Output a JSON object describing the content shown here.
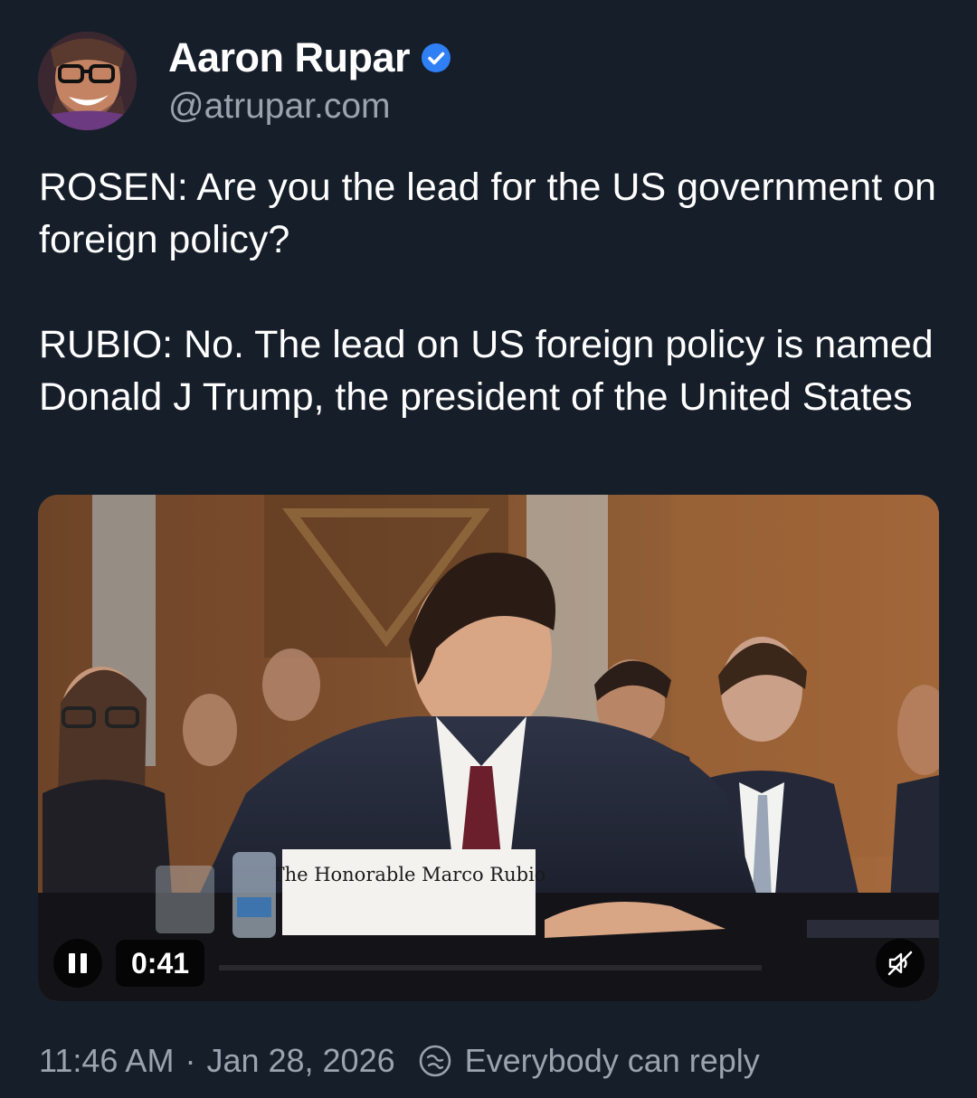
{
  "author": {
    "display_name": "Aaron Rupar",
    "handle": "@atrupar.com",
    "avatar_icon": "avatar",
    "verified_icon": "verified-badge-icon",
    "verified_color": "#2f7ff5"
  },
  "post": {
    "paragraphs": [
      "ROSEN: Are you the lead for the US government on foreign policy?",
      "RUBIO: No. The lead on US foreign policy is named Donald J Trump, the president of the United States"
    ]
  },
  "video": {
    "nameplate": "The Honorable Marco Rubio",
    "time": "0:41",
    "pause_icon": "pause-icon",
    "mute_icon": "muted-speaker-icon"
  },
  "footer": {
    "time": "11:46 AM",
    "separator": "·",
    "date": "Jan 28, 2026",
    "reply_icon": "reply-settings-icon",
    "reply_setting": "Everybody can reply"
  },
  "colors": {
    "background": "#161e2a",
    "text": "#ffffff",
    "muted": "#9aa3ae"
  }
}
